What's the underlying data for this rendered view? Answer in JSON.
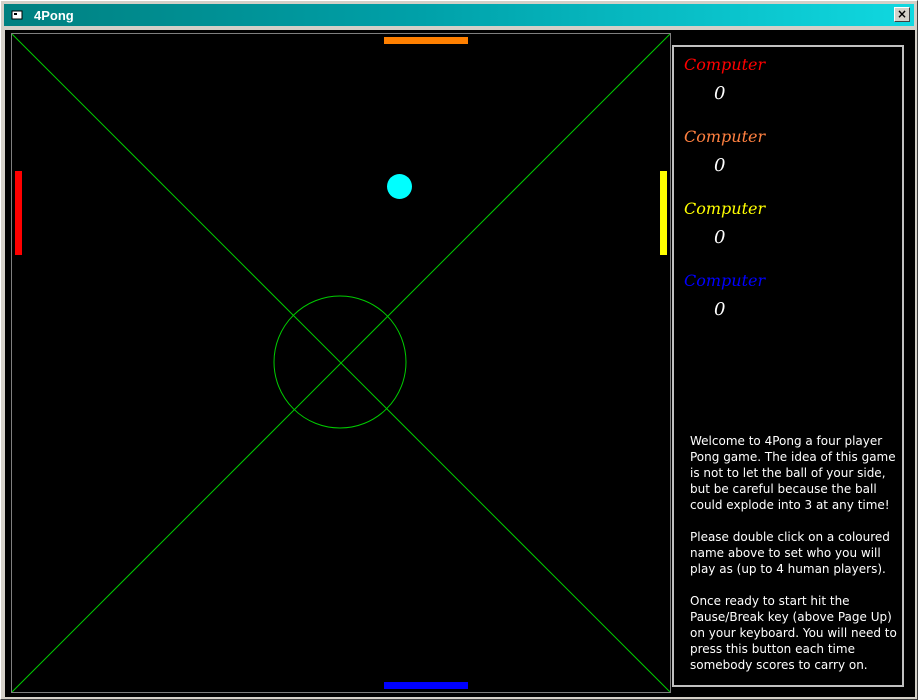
{
  "window": {
    "title": "4Pong",
    "close_label": "×"
  },
  "court": {
    "line_color": "#00cc00",
    "paddles": [
      {
        "name": "top",
        "color": "#ff8000"
      },
      {
        "name": "left",
        "color": "#ff0000"
      },
      {
        "name": "right",
        "color": "#ffff00"
      },
      {
        "name": "bottom",
        "color": "#0000ff"
      }
    ],
    "ball_color": "#00ffff"
  },
  "players": [
    {
      "name": "Computer",
      "score": "0",
      "color": "#ff0000"
    },
    {
      "name": "Computer",
      "score": "0",
      "color": "#ff8040"
    },
    {
      "name": "Computer",
      "score": "0",
      "color": "#ffff00"
    },
    {
      "name": "Computer",
      "score": "0",
      "color": "#0000ff"
    }
  ],
  "info": {
    "paragraph1": "Welcome to 4Pong a four player Pong game. The idea of this game is not to let the ball of your side, but be careful because the ball could explode into 3 at any time!",
    "paragraph2": "Please double click on a coloured name above to set who you will play as (up to 4 human players).",
    "paragraph3": "Once ready to start hit the Pause/Break key (above Page Up) on your keyboard. You will need to press this button each time somebody scores to carry on."
  }
}
